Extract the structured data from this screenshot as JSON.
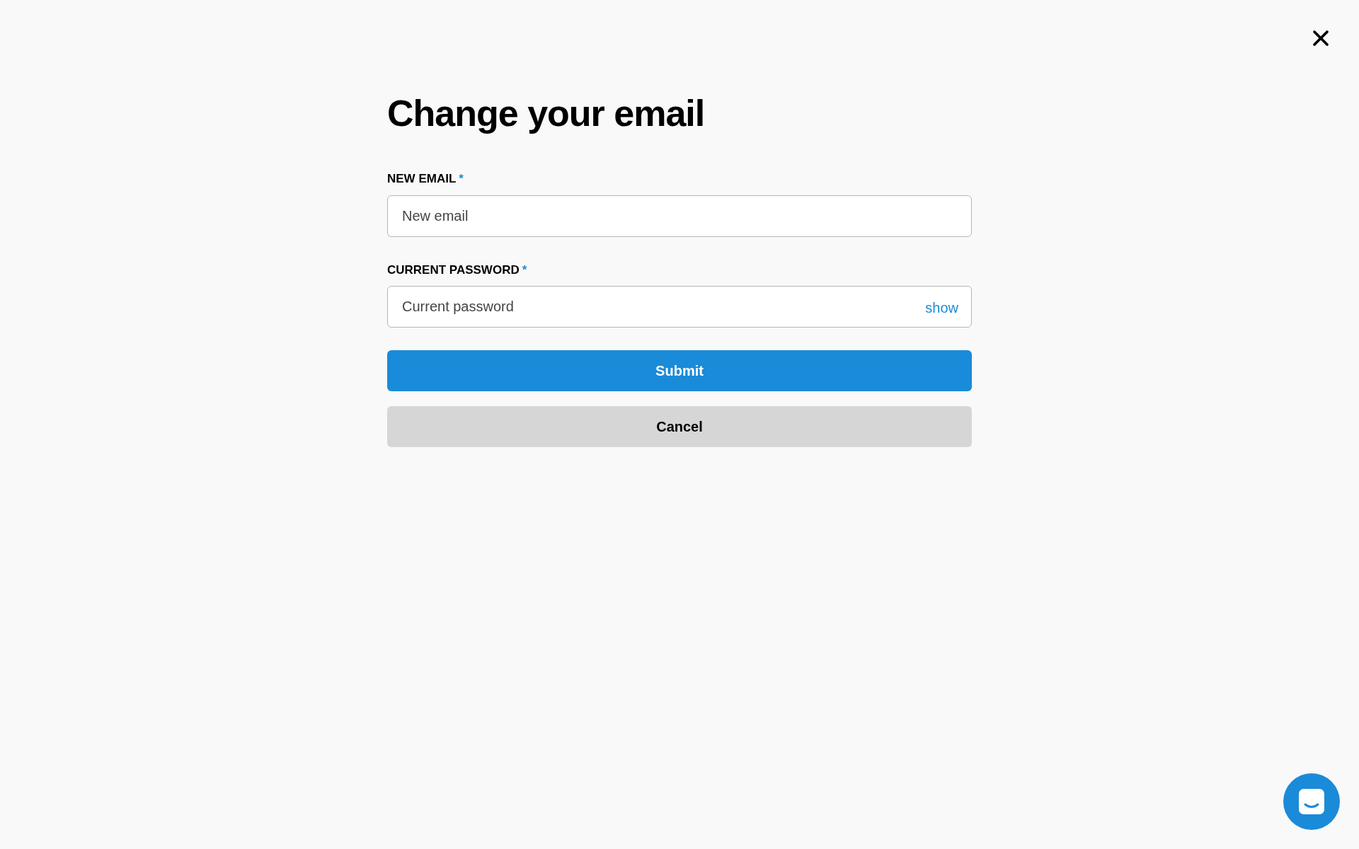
{
  "dialog": {
    "title": "Change your email",
    "fields": [
      {
        "label": "NEW EMAIL",
        "required_mark": "*",
        "placeholder": "New email"
      },
      {
        "label": "CURRENT PASSWORD",
        "required_mark": "*",
        "placeholder": "Current password",
        "toggle": "show"
      }
    ],
    "buttons": [
      {
        "label": "Submit",
        "kind": "primary"
      },
      {
        "label": "Cancel",
        "kind": "secondary"
      }
    ]
  }
}
